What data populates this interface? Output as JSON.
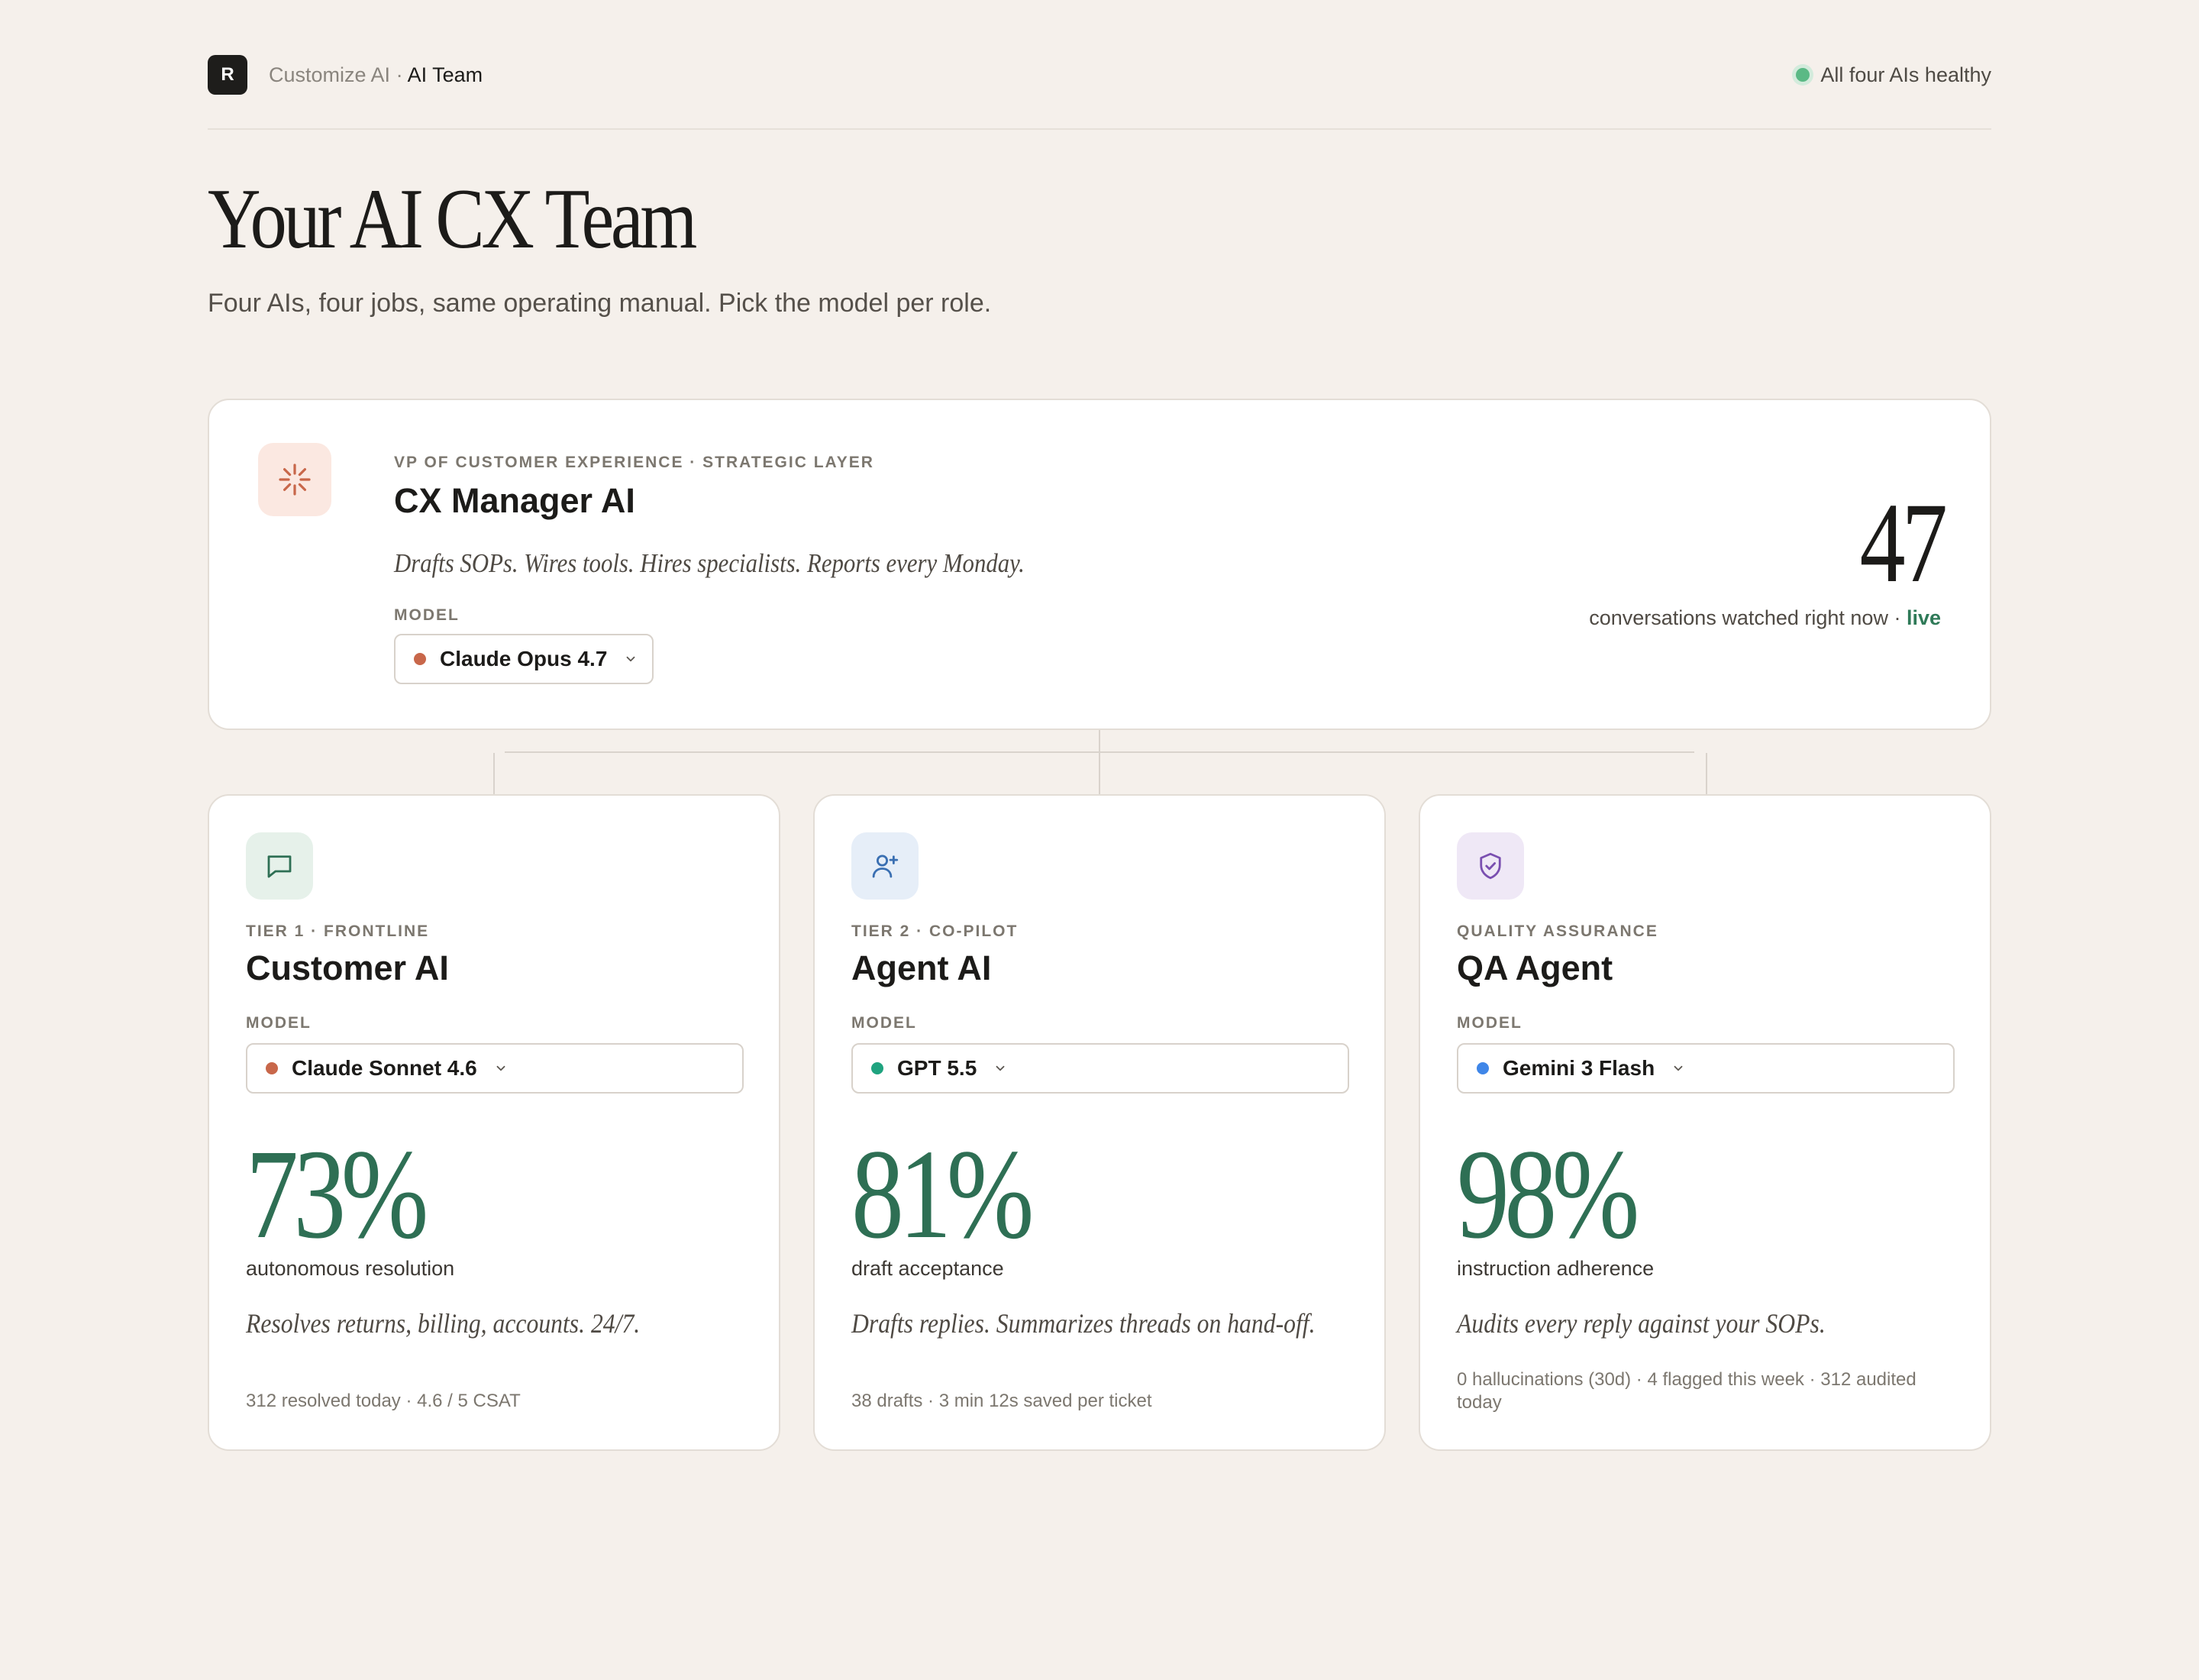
{
  "header": {
    "logo_letter": "R",
    "breadcrumb_parent": "Customize AI",
    "breadcrumb_separator": " · ",
    "breadcrumb_current": "AI Team",
    "health_status": "All four AIs healthy"
  },
  "page": {
    "title": "Your AI CX Team",
    "subtitle": "Four AIs, four jobs, same operating manual. Pick the model per role."
  },
  "manager": {
    "icon": "sparkle-icon",
    "eyebrow": "VP OF CUSTOMER EXPERIENCE · STRATEGIC LAYER",
    "title": "CX Manager AI",
    "tagline": "Drafts SOPs. Wires tools. Hires specialists. Reports every Monday.",
    "model_label": "MODEL",
    "model": "Claude Opus 4.7",
    "model_color": "#c8674a",
    "count": "47",
    "count_caption": "conversations watched right now · ",
    "count_live": "live"
  },
  "roles": [
    {
      "icon": "chat-bubble-icon",
      "eyebrow": "TIER 1 · FRONTLINE",
      "title": "Customer AI",
      "model_label": "MODEL",
      "model": "Claude Sonnet 4.6",
      "model_color": "#c8674a",
      "metric": "73%",
      "metric_caption": "autonomous resolution",
      "tagline": "Resolves returns, billing, accounts. 24/7.",
      "footnote": "312 resolved today · 4.6 / 5 CSAT"
    },
    {
      "icon": "user-plus-icon",
      "eyebrow": "TIER 2 · CO-PILOT",
      "title": "Agent AI",
      "model_label": "MODEL",
      "model": "GPT 5.5",
      "model_color": "#1fa37f",
      "metric": "81%",
      "metric_caption": "draft acceptance",
      "tagline": "Drafts replies. Summarizes threads on hand-off.",
      "footnote": "38 drafts · 3 min 12s saved per ticket"
    },
    {
      "icon": "shield-check-icon",
      "eyebrow": "QUALITY ASSURANCE",
      "title": "QA Agent",
      "model_label": "MODEL",
      "model": "Gemini 3 Flash",
      "model_color": "#3f86e8",
      "metric": "98%",
      "metric_caption": "instruction adherence",
      "tagline": "Audits every reply against your SOPs.",
      "footnote": "0 hallucinations (30d) · 4 flagged this week · 312 audited today"
    }
  ],
  "colors": {
    "background": "#f5f0eb",
    "accent_green": "#2e6f54",
    "health_green": "#5bb985"
  }
}
